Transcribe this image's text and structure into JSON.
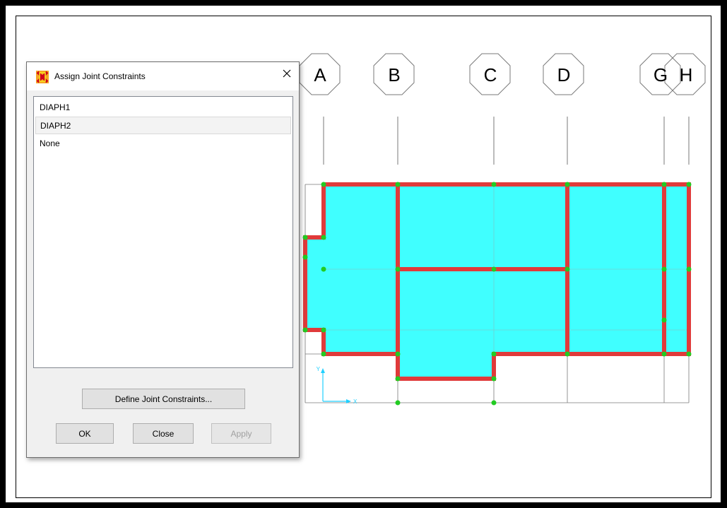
{
  "dialog": {
    "title": "Assign Joint Constraints",
    "close_label": "×",
    "constraints": [
      "DIAPH1",
      "DIAPH2",
      "None"
    ],
    "selected": "DIAPH2",
    "define_button": "Define Joint Constraints...",
    "ok_button": "OK",
    "close_button": "Close",
    "apply_button": "Apply"
  },
  "grid": {
    "labels": [
      "A",
      "B",
      "C",
      "D",
      "G",
      "H"
    ],
    "axis_x": "X",
    "axis_y": "Y"
  },
  "colors": {
    "slab_fill": "#40ffff",
    "beam": "#e03a3a",
    "joint": "#22cc22",
    "gridline": "#7a7a7a",
    "axis": "#20d0ff"
  }
}
